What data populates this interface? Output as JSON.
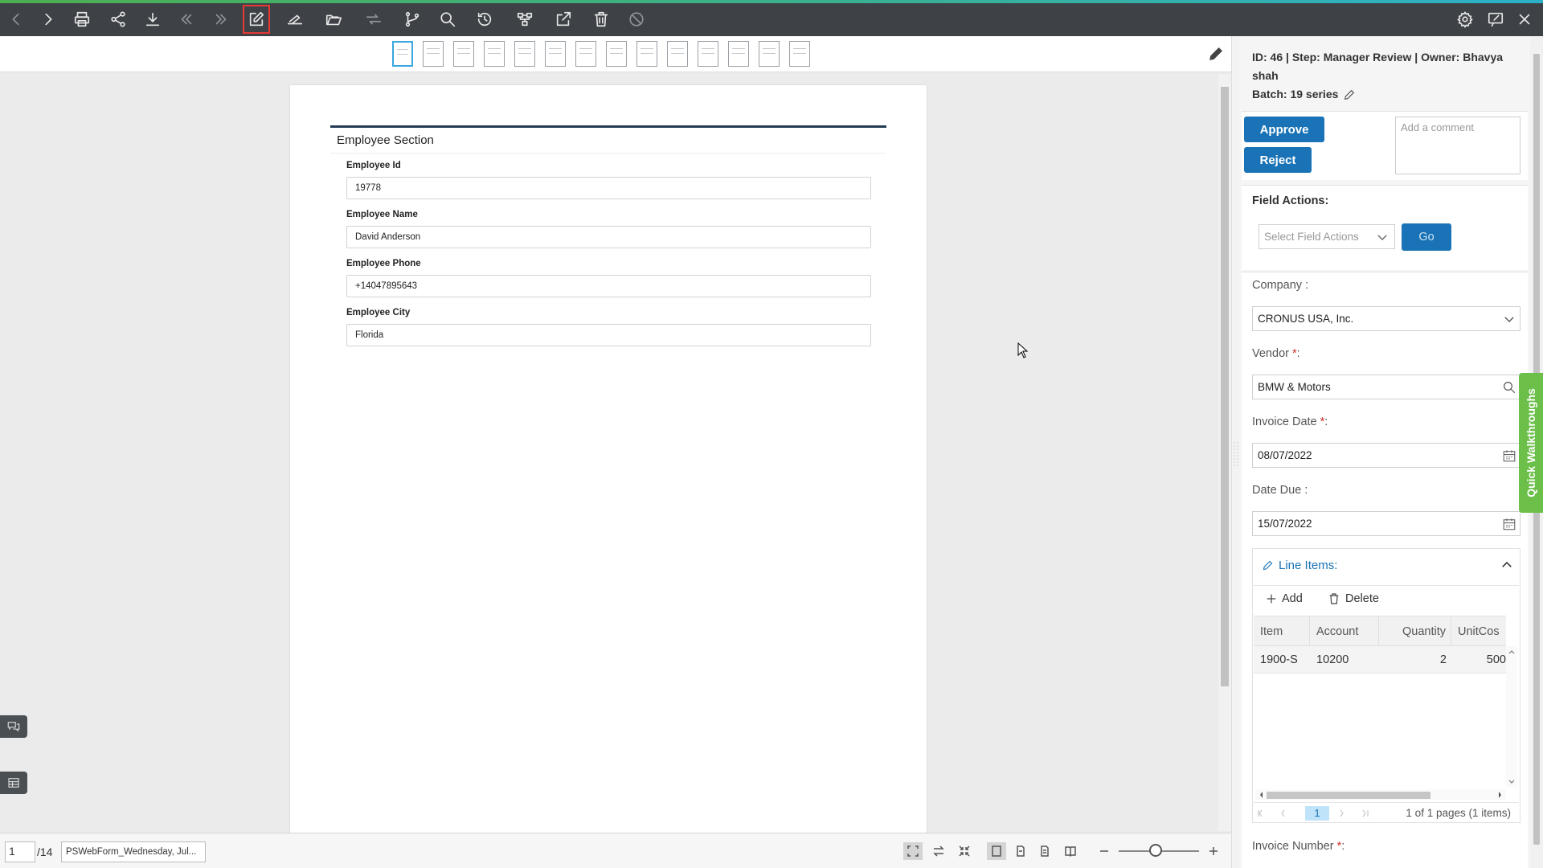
{
  "toolbar": {
    "left_icons": [
      "back-icon",
      "forward-icon",
      "print-icon",
      "share-icon",
      "download-icon",
      "first-icon",
      "last-icon",
      "edit-icon",
      "signature-icon",
      "folder-icon",
      "route-icon",
      "branch-icon",
      "search-icon",
      "history-icon",
      "workflow-icon",
      "export-icon",
      "delete-icon",
      "cancel-icon"
    ],
    "right_icons": [
      "settings-icon",
      "feedback-icon",
      "close-icon"
    ],
    "accent_colors": [
      "#4caf50",
      "#2bb0c8"
    ],
    "active_highlight": "#e53935"
  },
  "thumbnails": {
    "count": 14,
    "selected_index": 0
  },
  "document": {
    "section_title": "Employee Section",
    "fields": [
      {
        "label": "Employee Id",
        "value": "19778"
      },
      {
        "label": "Employee Name",
        "value": "David Anderson"
      },
      {
        "label": "Employee Phone",
        "value": "+14047895643"
      },
      {
        "label": "Employee City",
        "value": "Florida"
      }
    ]
  },
  "bottom": {
    "page_current": "1",
    "page_total": "/14",
    "file_name": "PSWebForm_Wednesday, Jul..."
  },
  "panel": {
    "header_line1": "ID: 46 | Step: Manager Review | Owner: Bhavya shah",
    "header_line2": "Batch: 19 series",
    "approve_label": "Approve",
    "reject_label": "Reject",
    "comment_placeholder": "Add a comment",
    "field_actions_label": "Field Actions:",
    "field_actions_placeholder": "Select Field Actions",
    "go_label": "Go",
    "company_label": "Company :",
    "company_value": "CRONUS USA, Inc.",
    "vendor_label": "Vendor ",
    "vendor_value": "BMW & Motors",
    "invoice_date_label": "Invoice Date ",
    "invoice_date_value": "08/07/2022",
    "date_due_label": "Date Due :",
    "date_due_value": "15/07/2022",
    "required_mark": "*",
    "required_suffix": ":",
    "line_items_label": "Line Items:",
    "add_label": "Add",
    "delete_label": "Delete",
    "columns": [
      "Item",
      "Account",
      "Quantity",
      "UnitCos"
    ],
    "rows": [
      {
        "item": "1900-S",
        "account": "10200",
        "quantity": "2",
        "unitcost": "500"
      }
    ],
    "pager_page": "1",
    "pager_info": "1 of 1 pages (1 items)",
    "invoice_number_label": "Invoice Number ",
    "quick_walkthroughs": "Quick Walkthroughs",
    "primary_color": "#1a73b6",
    "walkthrough_color": "#6cc04a"
  }
}
